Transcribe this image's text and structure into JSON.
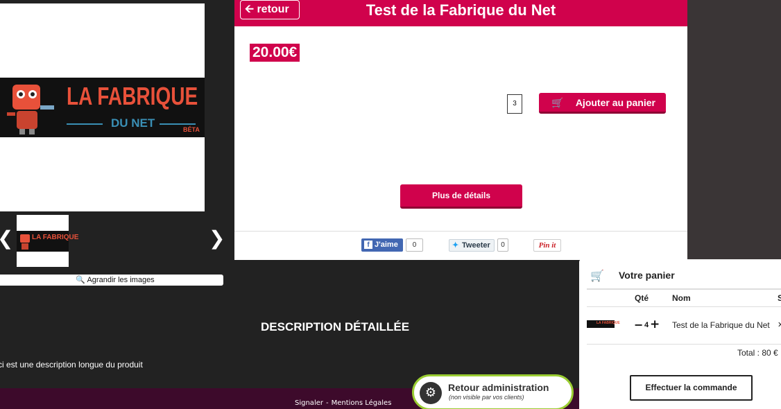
{
  "header": {
    "back_label": "retour",
    "back_icon": "arrow-left-icon",
    "title": "Test de la Fabrique du Net"
  },
  "product": {
    "price": "20.00€",
    "quantity": "3",
    "add_to_cart_label": "Ajouter au panier",
    "more_details_label": "Plus de détails"
  },
  "logo": {
    "main": "LA FABRIQUE",
    "sub": "DU NET",
    "beta": "BÉTA"
  },
  "gallery": {
    "prev": "❮",
    "next": "❯",
    "enlarge_label": "Agrandir les images",
    "thumb_text": "LA FABRIQUE"
  },
  "share": {
    "facebook_label": "J'aime",
    "facebook_count": "0",
    "twitter_label": "Tweeter",
    "twitter_count": "0",
    "pinterest_label": "Pin it"
  },
  "description": {
    "title": "DESCRIPTION DÉTAILLÉE",
    "text": "ci est une description longue du produit"
  },
  "footer": {
    "link1": "Signaler",
    "separator": "-",
    "link2": "Mentions Légales"
  },
  "admin": {
    "title": "Retour administration",
    "subtitle": "(non visible par vos clients)"
  },
  "cart": {
    "title": "Votre panier",
    "col_qty": "Qté",
    "col_name": "Nom",
    "col_extra": "S",
    "items": [
      {
        "name": "Test de la Fabrique du Net",
        "qty": "4",
        "thumb_text": "LA FABRIQUE"
      }
    ],
    "total": "Total : 80 €",
    "order_label": "Effectuer la commande"
  },
  "colors": {
    "brand": "#d0024c",
    "footer": "#3d0a2b",
    "admin_border": "#9acd32"
  }
}
